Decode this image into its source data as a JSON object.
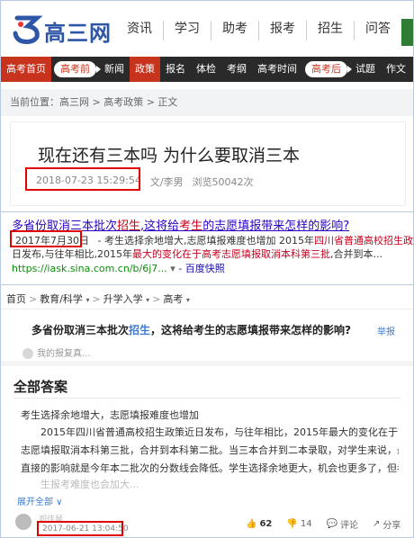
{
  "gaosan": {
    "logo_text": "高三网",
    "top_nav": [
      "资讯",
      "学习",
      "助考",
      "报考",
      "招生",
      "问答"
    ],
    "top_edge_text": "试",
    "channel_nav": [
      {
        "label": "高考首页",
        "style": "red"
      },
      {
        "label": "高考前",
        "style": "pill"
      },
      {
        "label": "新闻",
        "style": "plain"
      },
      {
        "label": "政策",
        "style": "red"
      },
      {
        "label": "报名",
        "style": "plain"
      },
      {
        "label": "体检",
        "style": "plain"
      },
      {
        "label": "考纲",
        "style": "plain"
      },
      {
        "label": "高考时间",
        "style": "plain"
      },
      {
        "label": "高考后",
        "style": "pill"
      },
      {
        "label": "试题",
        "style": "plain"
      },
      {
        "label": "作文",
        "style": "plain"
      }
    ],
    "breadcrumb": "当前位置：高三网 > 高考政策 > 正文",
    "article_title": "现在还有三本吗 为什么要取消三本",
    "article_datetime": "2018-07-23 15:29:54",
    "article_author": "文/李男",
    "article_views": "浏览50042次"
  },
  "search_result": {
    "title_pre": "多省份取消三本批次",
    "title_hl1": "招生",
    "title_mid": ",这将给",
    "title_hl2": "考生",
    "title_post": "的志愿填报带来怎样的影响?",
    "date": "2017年7月30日",
    "line1_pre": " - 考生选择余地增大,志愿填报难度也增加 2015年",
    "line1_hl": "四川省普通高校招生政策",
    "line1_post": "近",
    "line2_pre": "日发布,与往年相比,2015年",
    "line2_hl1": "最大的变化在于",
    "line2_hl2": "高考志愿填报取消本科第三批",
    "line2_post": ",合并到本...",
    "url": "https://iask.sina.com.cn/b/6j7...",
    "snapshot": "- 百度快照"
  },
  "zhidao": {
    "breadcrumb": [
      "首页",
      "教育/科学",
      "升学入学",
      "高考"
    ],
    "question_pre": "多省份取消三本批次",
    "question_hl": "招生",
    "question_post": "，这将给考生的志愿填报带来怎样的影响?",
    "report": "举报",
    "my_answer": "我的报复真...",
    "all_answers": "全部答案",
    "answer_lead": "考生选择余地增大，志愿填报难度也增加",
    "answer_lines": [
      "　　2015年四川省普通高校招生政策近日发布，与往年相比，2015年最大的变化在于高考",
      "志愿填报取消本科第三批，合并到本科第二批。当三本合并到二本录取，对学生来说，最",
      "直接的影响就是今年本二批次的分数线会降低。学生选择余地更大，机会也更多了，但考"
    ],
    "answer_fade": "　　生报考难度也会加大...",
    "expand": "展开全部 ∨",
    "user_name": "郑佳琴",
    "answer_time": "2017-06-21 13:04:50",
    "like_count": "62",
    "dislike_count": "14",
    "comment_label": "评论",
    "share_label": "分享"
  },
  "colors": {
    "brand_blue": "#2e56a7",
    "nav_red": "#c8331e",
    "highlight_box": "#e00000",
    "link_blue": "#2a00c6"
  }
}
